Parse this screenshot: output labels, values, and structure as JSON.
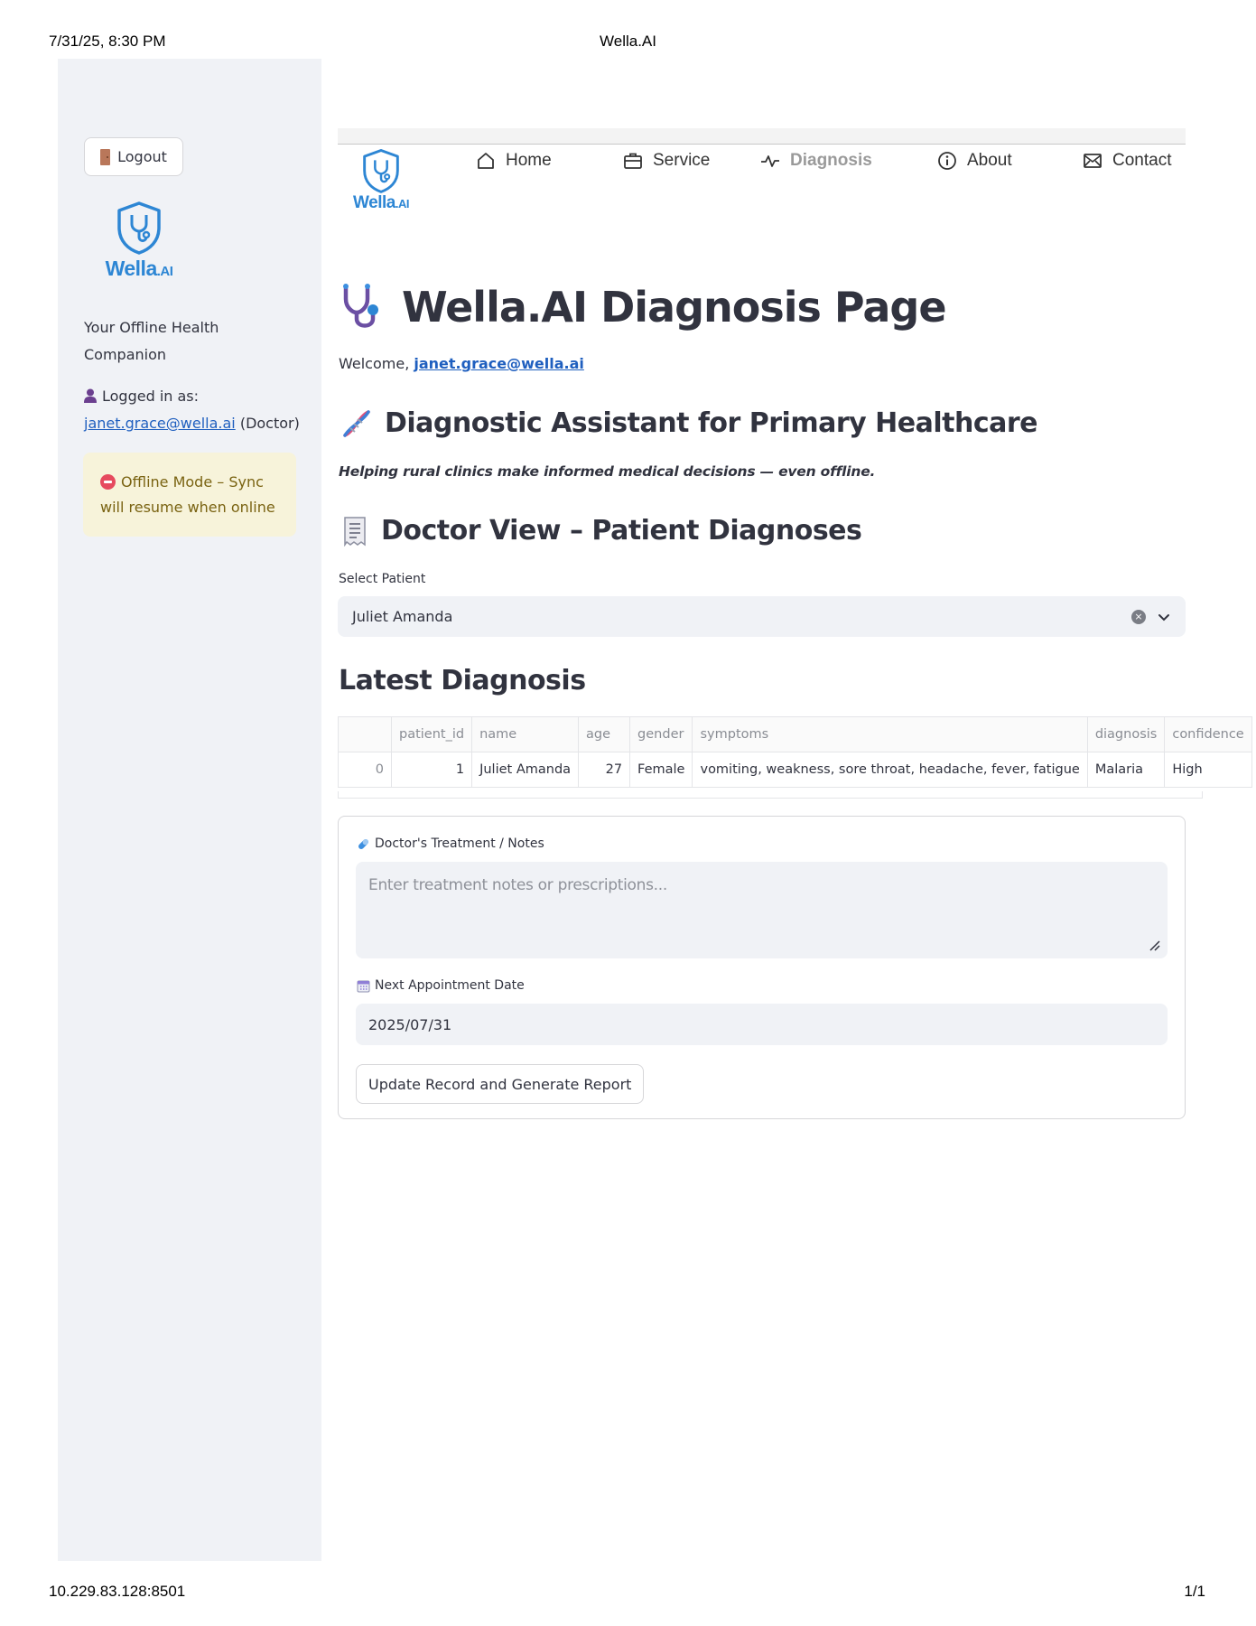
{
  "print": {
    "datetime": "7/31/25, 8:30 PM",
    "title": "Wella.AI",
    "url": "10.229.83.128:8501",
    "page": "1/1"
  },
  "sidebar": {
    "logout_label": "Logout",
    "logo_text": "Wella",
    "logo_suffix": ".AI",
    "tagline": "Your Offline Health Companion",
    "logged_in_label": "Logged in as:",
    "user_email": "janet.grace@wella.ai",
    "user_role": "(Doctor)",
    "offline_message": "Offline Mode – Sync will resume when online"
  },
  "nav": {
    "logo_text": "Wella",
    "logo_suffix": ".AI",
    "items": [
      {
        "label": "Home",
        "icon": "home-icon"
      },
      {
        "label": "Service",
        "icon": "briefcase-icon"
      },
      {
        "label": "Diagnosis",
        "icon": "activity-icon",
        "active": true
      },
      {
        "label": "About",
        "icon": "info-icon"
      },
      {
        "label": "Contact",
        "icon": "envelope-icon"
      }
    ]
  },
  "main": {
    "title": "Wella.AI Diagnosis Page",
    "welcome_prefix": "Welcome,",
    "welcome_email": "janet.grace@wella.ai",
    "assistant_heading": "Diagnostic Assistant for Primary Healthcare",
    "assistant_subtitle": "Helping rural clinics make informed medical decisions — even offline.",
    "doctor_view_heading": "Doctor View – Patient Diagnoses",
    "select_label": "Select Patient",
    "selected_patient": "Juliet Amanda",
    "latest_heading": "Latest Diagnosis",
    "table": {
      "columns": [
        "",
        "patient_id",
        "name",
        "age",
        "gender",
        "symptoms",
        "diagnosis",
        "confidence"
      ],
      "rows": [
        [
          "0",
          "1",
          "Juliet Amanda",
          "27",
          "Female",
          "vomiting, weakness, sore throat, headache, fever, fatigue",
          "Malaria",
          "High"
        ]
      ]
    },
    "form": {
      "notes_label": "Doctor's Treatment / Notes",
      "notes_placeholder": "Enter treatment notes or prescriptions...",
      "date_label": "Next Appointment Date",
      "date_value": "2025/07/31",
      "submit_label": "Update Record and Generate Report"
    }
  },
  "colors": {
    "brand": "#2d86d4",
    "sidebar_bg": "#f0f2f6",
    "warning_bg": "#f7f3da",
    "warning_text": "#7a6312",
    "link": "#1f5fbf"
  }
}
